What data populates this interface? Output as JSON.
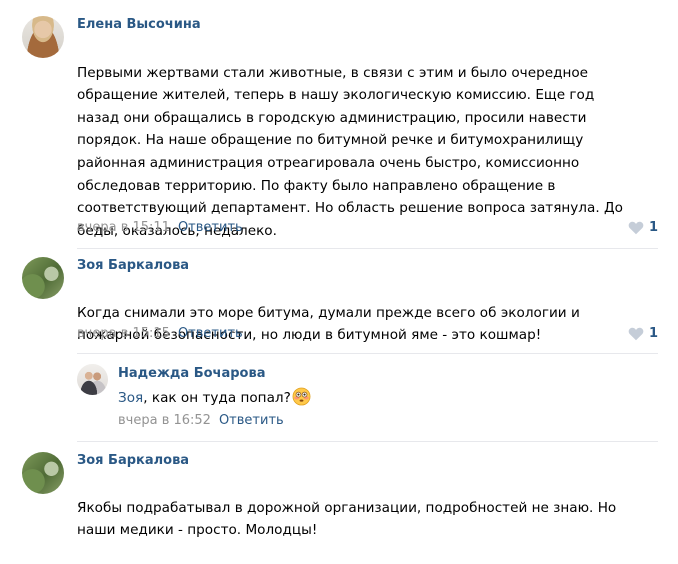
{
  "comments": [
    {
      "author": "Елена Высочина",
      "lines": [
        "Первыми жертвами стали животные, в связи с этим и было очередное",
        "обращение жителей, теперь в нашу экологическую комиссию. Еще год",
        "назад они обращались в городскую администрацию, просили навести",
        "порядок. На наше обращение по битумной речке и битумохранилищу",
        "районная администрация отреагировала очень быстро, комиссионно",
        "обследовав территорию. По факту было направлено обращение в",
        "соответствующий департамент. Но область решение вопроса затянула. До",
        "беды, оказалось, недалеко."
      ],
      "time": "вчера в 15:11",
      "reply_label": "Ответить",
      "likes": "1"
    },
    {
      "author": "Зоя Баркалова",
      "lines": [
        "Когда снимали это море битума, думали прежде всего об экологии и",
        "пожарной безопасности, но люди в битумной яме - это кошмар!"
      ],
      "time": "вчера в 15:15",
      "reply_label": "Ответить",
      "likes": "1"
    },
    {
      "author": "Надежда Бочарова",
      "mention": "Зоя",
      "text": ", как он туда попал?",
      "emoji": "flushed-face-emoji",
      "time": "вчера в 16:52",
      "reply_label": "Ответить"
    },
    {
      "author": "Зоя Баркалова",
      "lines": [
        "Якобы подрабатывал в дорожной организации, подробностей не знаю. Но",
        "наши медики - просто. Молодцы!"
      ]
    }
  ],
  "colors": {
    "link": "#2a5885",
    "meta": "#939393",
    "divider": "#e7e8ec",
    "heart": "#c5cdd8"
  },
  "icons": {
    "like": "heart-icon"
  }
}
